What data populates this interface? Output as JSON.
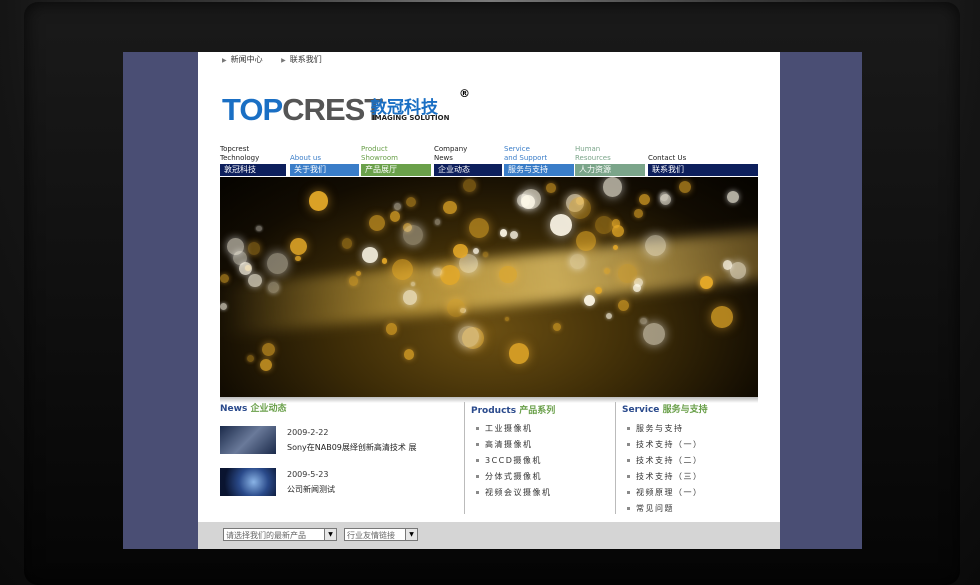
{
  "top_links": [
    "新闻中心",
    "联系我们"
  ],
  "logo": {
    "brand_a": "TOP",
    "brand_b": "CREST",
    "cn": "敦冠科技",
    "reg": "®",
    "sub": "IMAGING SOLUTION"
  },
  "nav": [
    {
      "en": "Topcrest\nTechnology",
      "cn": "敦冠科技",
      "en_color": "#222",
      "cn_bg": "#0d1f5c"
    },
    {
      "en": "About us",
      "cn": "关于我们",
      "en_color": "#3a7dc8",
      "cn_bg": "#3a7dc8"
    },
    {
      "en": "Product\nShowroom",
      "cn": "产品展厅",
      "en_color": "#6aa04a",
      "cn_bg": "#6aa04a"
    },
    {
      "en": "Company\nNews",
      "cn": "企业动态",
      "en_color": "#222",
      "cn_bg": "#0d1f5c"
    },
    {
      "en": "Service\nand Support",
      "cn": "服务与支持",
      "en_color": "#3a7dc8",
      "cn_bg": "#3a7dc8"
    },
    {
      "en": "Human\nResources",
      "cn": "人力资源",
      "en_color": "#7ba58a",
      "cn_bg": "#7ba58a"
    },
    {
      "en": "Contact Us",
      "cn": "联系我们",
      "en_color": "#222",
      "cn_bg": "#0d1f5c"
    }
  ],
  "news": {
    "title_en": "News",
    "title_cn": "企业动态",
    "items": [
      {
        "date": "2009-2-22",
        "text": "Sony在NAB09展绎创新高清技术 展"
      },
      {
        "date": "2009-5-23",
        "text": "公司新闻测试"
      }
    ]
  },
  "products": {
    "title_en": "Products",
    "title_cn": "产品系列",
    "items": [
      "工业摄像机",
      "高清摄像机",
      "3CCD摄像机",
      "分体式摄像机",
      "视频会议摄像机"
    ]
  },
  "service": {
    "title_en": "Service",
    "title_cn": "服务与支持",
    "items": [
      "服务与支持",
      "技术支持（一）",
      "技术支持（二）",
      "技术支持（三）",
      "视频原理（一）",
      "常见问题"
    ]
  },
  "footer": {
    "select1": "请选择我们的最新产品",
    "select2": "行业友情链接"
  }
}
